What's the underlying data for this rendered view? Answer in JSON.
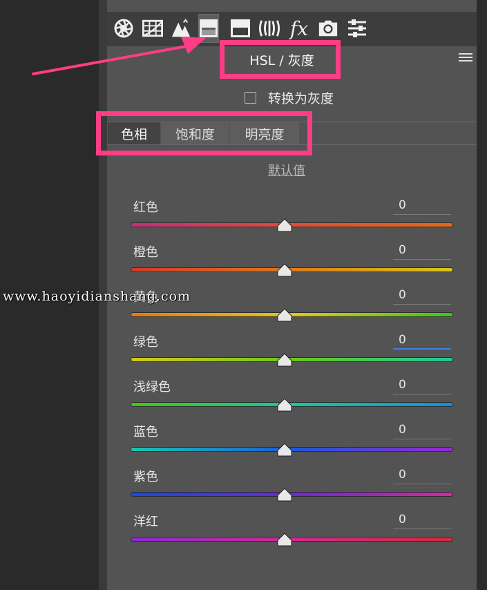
{
  "toolbar": {
    "icons": [
      {
        "name": "basic-aperture-icon"
      },
      {
        "name": "tone-curve-grid-icon"
      },
      {
        "name": "detail-triangle-icon"
      },
      {
        "name": "hsl-grayscale-icon",
        "active": true
      },
      {
        "name": "split-toning-icon"
      },
      {
        "name": "lens-corrections-icon"
      },
      {
        "name": "effects-icon",
        "glyph": "fx"
      },
      {
        "name": "camera-calibration-icon"
      },
      {
        "name": "presets-sliders-icon"
      }
    ]
  },
  "panel": {
    "title": "HSL / 灰度",
    "convert_to_grayscale_label": "转换为灰度",
    "convert_to_grayscale_checked": false
  },
  "tabs": [
    {
      "label": "色相",
      "active": true
    },
    {
      "label": "饱和度",
      "active": false
    },
    {
      "label": "明亮度",
      "active": false
    }
  ],
  "defaults_label": "默认值",
  "sliders": [
    {
      "label": "红色",
      "value": "0",
      "level": 0.5,
      "gradient": [
        "#c0307a",
        "#d8503a",
        "#e06a18"
      ]
    },
    {
      "label": "橙色",
      "value": "0",
      "level": 0.5,
      "gradient": [
        "#d23a2a",
        "#e07a1a",
        "#d8c81a"
      ]
    },
    {
      "label": "黄色",
      "value": "0",
      "level": 0.5,
      "gradient": [
        "#e07a1a",
        "#e2c71c",
        "#3ec41c"
      ]
    },
    {
      "label": "绿色",
      "value": "0",
      "level": 0.5,
      "gradient": [
        "#d8c81a",
        "#6ac818",
        "#1cc8a0"
      ],
      "focused": true
    },
    {
      "label": "浅绿色",
      "value": "0",
      "level": 0.5,
      "gradient": [
        "#44c418",
        "#18c89a",
        "#1a8ad8"
      ]
    },
    {
      "label": "蓝色",
      "value": "0",
      "level": 0.5,
      "gradient": [
        "#18c8b0",
        "#1a5ad8",
        "#9a28d0"
      ]
    },
    {
      "label": "紫色",
      "value": "0",
      "level": 0.5,
      "gradient": [
        "#1a4ad8",
        "#6a2ad0",
        "#d02aa0"
      ]
    },
    {
      "label": "洋红",
      "value": "0",
      "level": 0.5,
      "gradient": [
        "#8a2ad0",
        "#d02a90",
        "#d02a3a"
      ]
    }
  ],
  "watermark": "www.haoyidianshang.com",
  "colors": {
    "highlight": "#ff3d86",
    "panel_bg": "#535353",
    "focus_underline": "#3b82e0"
  }
}
